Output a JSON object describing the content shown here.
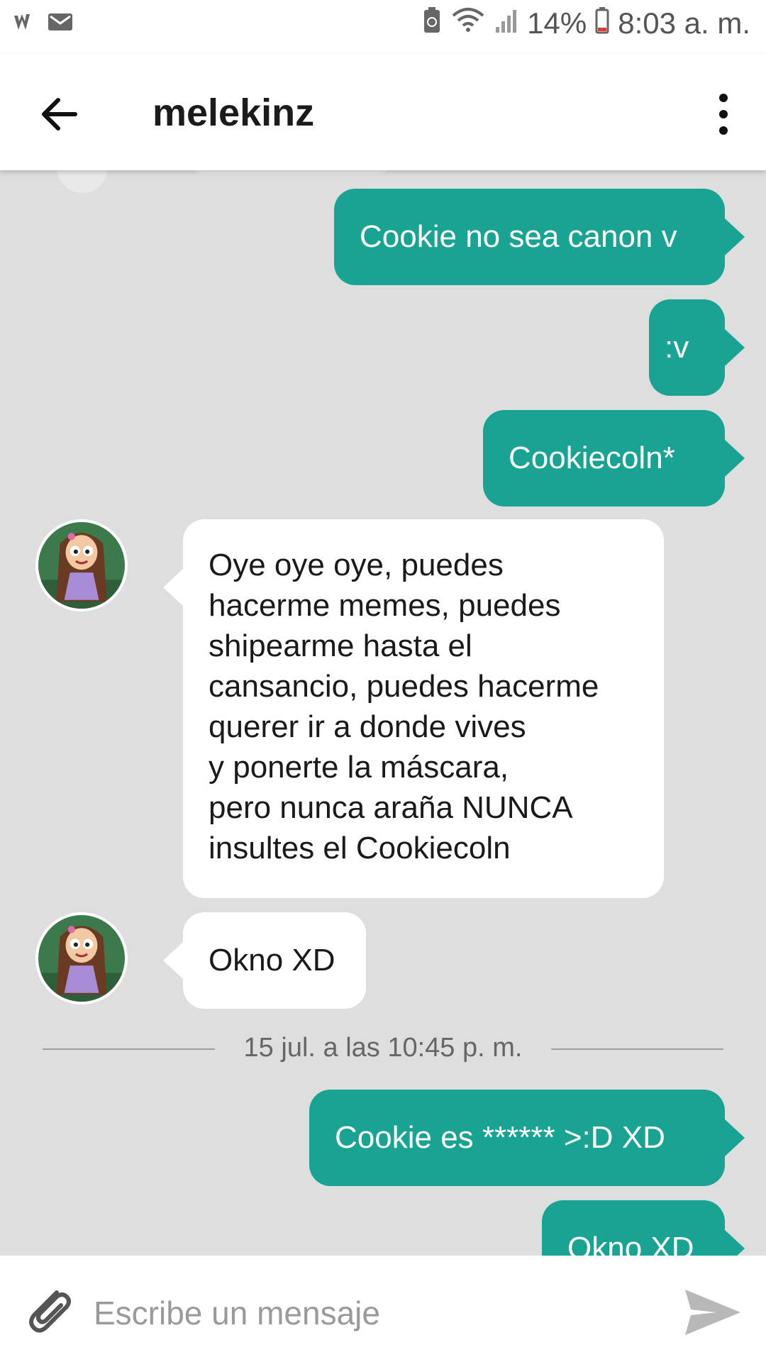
{
  "status_bar": {
    "battery_percent": "14%",
    "time": "8:03 a. m.",
    "icons": [
      "wattpad-icon",
      "mail-icon",
      "battery-saver-icon",
      "wifi-icon",
      "signal-icon",
      "battery-icon"
    ]
  },
  "header": {
    "title": "melekinz",
    "back_icon": "arrow-left-icon",
    "menu_icon": "more-vert-icon"
  },
  "messages": [
    {
      "direction": "outgoing",
      "text": "Cookie no sea canon v"
    },
    {
      "direction": "outgoing",
      "text": ":v"
    },
    {
      "direction": "outgoing",
      "text": "Cookiecoln*"
    },
    {
      "direction": "incoming",
      "lines": [
        "Oye oye oye, puedes",
        "hacerme memes, puedes",
        "shipearme hasta el",
        "cansancio, puedes hacerme",
        "querer ir a donde vives",
        "y ponerte la máscara,",
        "pero nunca araña NUNCA",
        "insultes el Cookiecoln"
      ]
    },
    {
      "direction": "incoming",
      "text": "Okno XD"
    },
    {
      "direction": "outgoing",
      "text": "Cookie es ****** >:D XD"
    },
    {
      "direction": "outgoing",
      "text": "Okno XD"
    }
  ],
  "date_separator": "15 jul. a las 10:45 p. m.",
  "composer": {
    "placeholder": "Escribe un mensaje",
    "attach_icon": "paperclip-icon",
    "send_icon": "send-icon"
  },
  "colors": {
    "outgoing_bubble": "#19a392",
    "incoming_bubble": "#ffffff",
    "chat_background": "#dedede"
  }
}
